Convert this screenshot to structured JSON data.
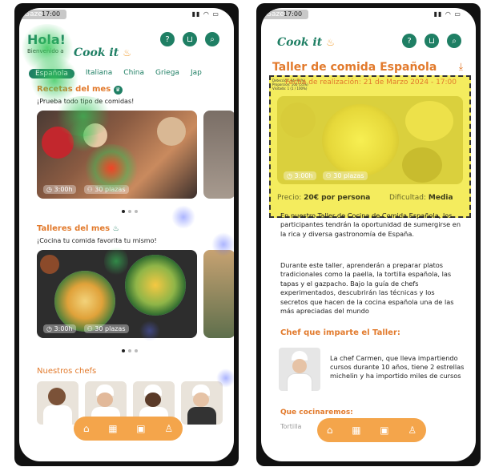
{
  "left": {
    "status": {
      "gaze": "Gaze",
      "time": "17:00",
      "icons": "▮▮ ◠ ▭"
    },
    "greeting": "Hola!",
    "welcome": "Bienvenido a",
    "brand": "Cook it",
    "tabs": [
      "Española",
      "Italiana",
      "China",
      "Griega",
      "Jap"
    ],
    "recetas": {
      "title": "Recetas del mes",
      "subtitle": "¡Prueba todo tipo de comidas!"
    },
    "card1": {
      "time": "3:00h",
      "places": "30 plazas"
    },
    "talleres": {
      "title": "Talleres del mes",
      "subtitle": "¡Cocina tu comida favorita tu mismo!"
    },
    "card2": {
      "time": "3:00h",
      "places": "30 plazas"
    },
    "chefs_title": "Nuestros chefs"
  },
  "right": {
    "status": {
      "gaze": "Gaze",
      "time": "17:00",
      "icons": "▮▮ ◠ ▭"
    },
    "brand": "Cook it",
    "title": "Taller de comida Española",
    "date": "Fecha de realización: 21 de Marzo 2024 - 17:00",
    "overlay_note": [
      "Detección: 94 (94%)",
      "Proporción: 100 (55%)",
      "Visitado: 1 (1 / 100%)"
    ],
    "hero": {
      "time": "3:00h",
      "places": "30 plazas"
    },
    "price_label": "Precio:",
    "price_value": "20€ por persona",
    "difficulty_label": "Dificultad:",
    "difficulty_value": "Media",
    "paragraph1": "En nuestro Taller de Cocina de Comida Española, los participantes tendrán la oportunidad de sumergirse en la rica y diversa gastronomía de España.",
    "paragraph2": "Durante este taller, aprenderán a preparar platos tradicionales como la paella, la tortilla española, las tapas y el gazpacho. Bajo la guía de chefs experimentados, descubrirán las técnicas y los secretos que hacen de la cocina española una de las más apreciadas del mundo",
    "chef_title": "Chef que imparte el Taller:",
    "chef_text": "La chef Carmen, que lleva impartiendo cursos durante 10 años, tiene 2 estrellas michelin y ha importido miles de cursos",
    "que_title": "Que cocinaremos:",
    "tortilla": "Tortilla"
  },
  "colors": {
    "primary": "#1f7f64",
    "accent": "#e27a2c",
    "nav": "#f4a54b",
    "heat_green": "#34c759",
    "heat_red": "#ff2a2a",
    "heat_blue": "#5a6cff",
    "highlight": "#f0e628"
  },
  "icons": [
    "help-icon",
    "cart-icon",
    "search-icon",
    "home-icon",
    "calendar-icon",
    "gallery-icon",
    "profile-icon",
    "download-icon",
    "clock-icon",
    "people-icon",
    "chef-hat-icon",
    "pot-icon"
  ]
}
